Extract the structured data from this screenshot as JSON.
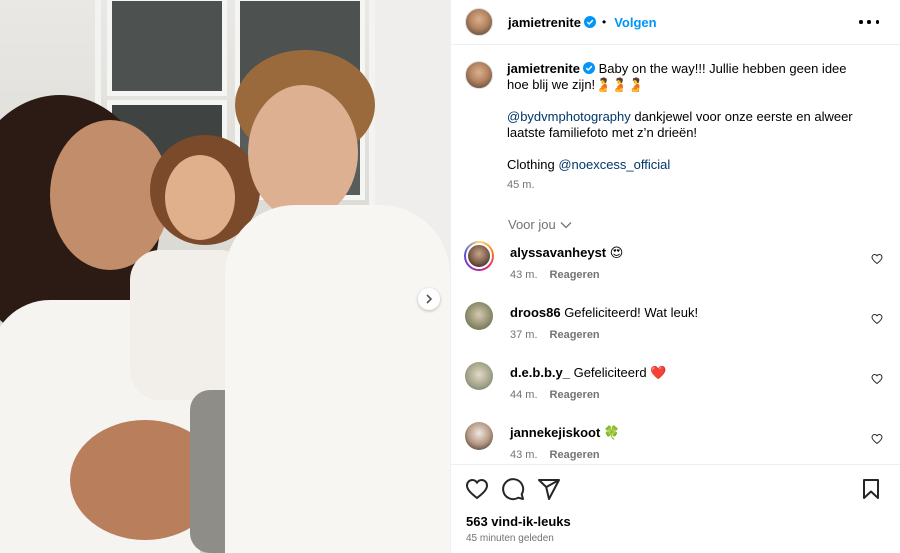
{
  "post": {
    "author": "jamietrenite",
    "follow_label": "Volgen",
    "dot": "•",
    "caption": {
      "text1": "Baby on the way!!! Jullie hebben geen idee hoe blij we zijn!",
      "emoji1": "🫄🫄🫄",
      "mention1": "@bydvmphotography",
      "text2": " dankjewel voor onze eerste en alweer laatste familiefoto met z’n drieën!",
      "clothing_label": "Clothing ",
      "mention2": "@noexcess_official",
      "time": "45 m."
    },
    "for_you_label": "Voor jou",
    "likes": "563 vind-ik-leuks",
    "posted_ago": "45 minuten geleden"
  },
  "comments": [
    {
      "user": "alyssavanheyst",
      "text": " 😍",
      "time": "43 m.",
      "reply": "Reageren"
    },
    {
      "user": "droos86",
      "text": " Gefeliciteerd! Wat leuk!",
      "time": "37 m.",
      "reply": "Reageren"
    },
    {
      "user": "d.e.b.b.y_",
      "text": " Gefeliciteerd ❤️",
      "time": "44 m.",
      "reply": "Reageren"
    },
    {
      "user": "jannekejiskoot",
      "text": " 🍀",
      "time": "43 m.",
      "reply": "Reageren"
    }
  ],
  "icons": [
    "verified-icon",
    "more-options-icon",
    "heart-icon",
    "comment-icon",
    "share-icon",
    "bookmark-icon",
    "chevron-right-icon",
    "chevron-down-icon"
  ],
  "colors": {
    "accent": "#0095f6",
    "link": "#00376b",
    "muted": "#737373"
  }
}
